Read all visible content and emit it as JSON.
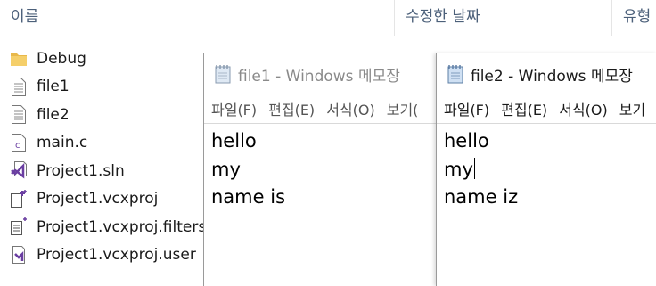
{
  "explorer": {
    "columns": {
      "name": "이름",
      "date": "수정한 날짜",
      "type": "유형"
    },
    "files": [
      {
        "name": "Debug",
        "icon": "folder-icon"
      },
      {
        "name": "file1",
        "icon": "text-file-icon"
      },
      {
        "name": "file2",
        "icon": "text-file-icon"
      },
      {
        "name": "main.c",
        "icon": "c-source-file-icon"
      },
      {
        "name": "Project1.sln",
        "icon": "visual-studio-solution-icon"
      },
      {
        "name": "Project1.vcxproj",
        "icon": "vcxproj-file-icon"
      },
      {
        "name": "Project1.vcxproj.filters",
        "icon": "vcxproj-filters-file-icon"
      },
      {
        "name": "Project1.vcxproj.user",
        "icon": "vcxproj-user-file-icon"
      }
    ]
  },
  "notepad1": {
    "title": "file1 - Windows 메모장",
    "menu": [
      "파일(F)",
      "편집(E)",
      "서식(O)",
      "보기("
    ],
    "lines": [
      "hello",
      "my",
      "name is"
    ]
  },
  "notepad2": {
    "title": "file2 - Windows 메모장",
    "menu": [
      "파일(F)",
      "편집(E)",
      "서식(O)",
      "보기"
    ],
    "lines": [
      "hello",
      "my",
      "name iz"
    ]
  },
  "colors": {
    "folder": "#e8b84a",
    "accent": "#6a3ea1",
    "header_text": "#4c607a"
  }
}
